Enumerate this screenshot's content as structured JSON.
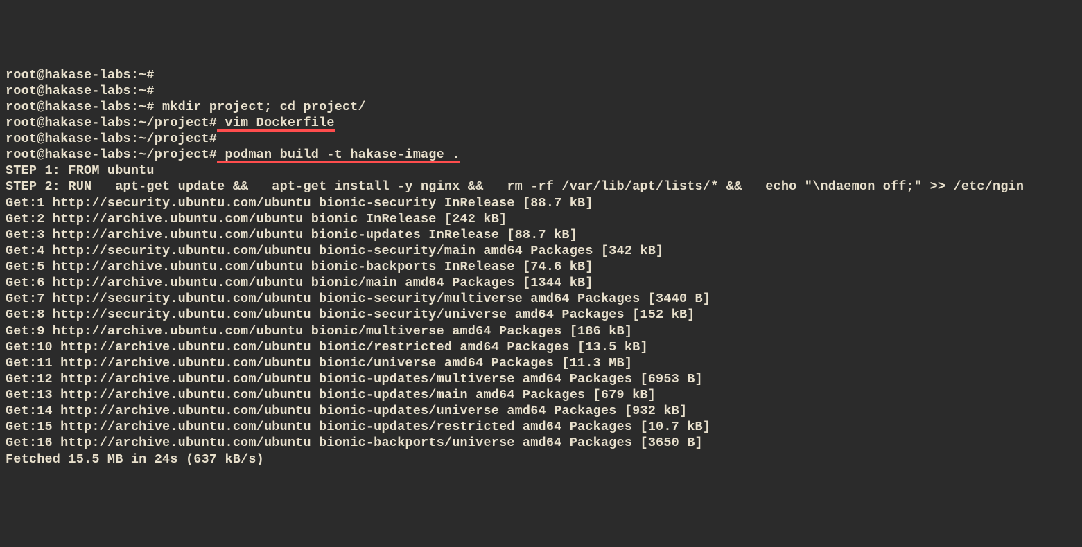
{
  "lines": [
    {
      "prompt": "root@hakase-labs:~#",
      "cmd": "",
      "underline": false
    },
    {
      "prompt": "root@hakase-labs:~#",
      "cmd": "",
      "underline": false
    },
    {
      "prompt": "root@hakase-labs:~#",
      "cmd": " mkdir project; cd project/",
      "underline": false
    },
    {
      "prompt": "root@hakase-labs:~/project#",
      "cmd": " vim Dockerfile",
      "underline": true
    },
    {
      "prompt": "root@hakase-labs:~/project#",
      "cmd": "",
      "underline": false
    },
    {
      "prompt": "root@hakase-labs:~/project#",
      "cmd": " podman build -t hakase-image .",
      "underline": true
    }
  ],
  "output": [
    "STEP 1: FROM ubuntu",
    "STEP 2: RUN   apt-get update &&   apt-get install -y nginx &&   rm -rf /var/lib/apt/lists/* &&   echo \"\\ndaemon off;\" >> /etc/ngin",
    "Get:1 http://security.ubuntu.com/ubuntu bionic-security InRelease [88.7 kB]",
    "Get:2 http://archive.ubuntu.com/ubuntu bionic InRelease [242 kB]",
    "Get:3 http://archive.ubuntu.com/ubuntu bionic-updates InRelease [88.7 kB]",
    "Get:4 http://security.ubuntu.com/ubuntu bionic-security/main amd64 Packages [342 kB]",
    "Get:5 http://archive.ubuntu.com/ubuntu bionic-backports InRelease [74.6 kB]",
    "Get:6 http://archive.ubuntu.com/ubuntu bionic/main amd64 Packages [1344 kB]",
    "Get:7 http://security.ubuntu.com/ubuntu bionic-security/multiverse amd64 Packages [3440 B]",
    "Get:8 http://security.ubuntu.com/ubuntu bionic-security/universe amd64 Packages [152 kB]",
    "Get:9 http://archive.ubuntu.com/ubuntu bionic/multiverse amd64 Packages [186 kB]",
    "Get:10 http://archive.ubuntu.com/ubuntu bionic/restricted amd64 Packages [13.5 kB]",
    "Get:11 http://archive.ubuntu.com/ubuntu bionic/universe amd64 Packages [11.3 MB]",
    "Get:12 http://archive.ubuntu.com/ubuntu bionic-updates/multiverse amd64 Packages [6953 B]",
    "Get:13 http://archive.ubuntu.com/ubuntu bionic-updates/main amd64 Packages [679 kB]",
    "Get:14 http://archive.ubuntu.com/ubuntu bionic-updates/universe amd64 Packages [932 kB]",
    "Get:15 http://archive.ubuntu.com/ubuntu bionic-updates/restricted amd64 Packages [10.7 kB]",
    "Get:16 http://archive.ubuntu.com/ubuntu bionic-backports/universe amd64 Packages [3650 B]",
    "Fetched 15.5 MB in 24s (637 kB/s)"
  ]
}
